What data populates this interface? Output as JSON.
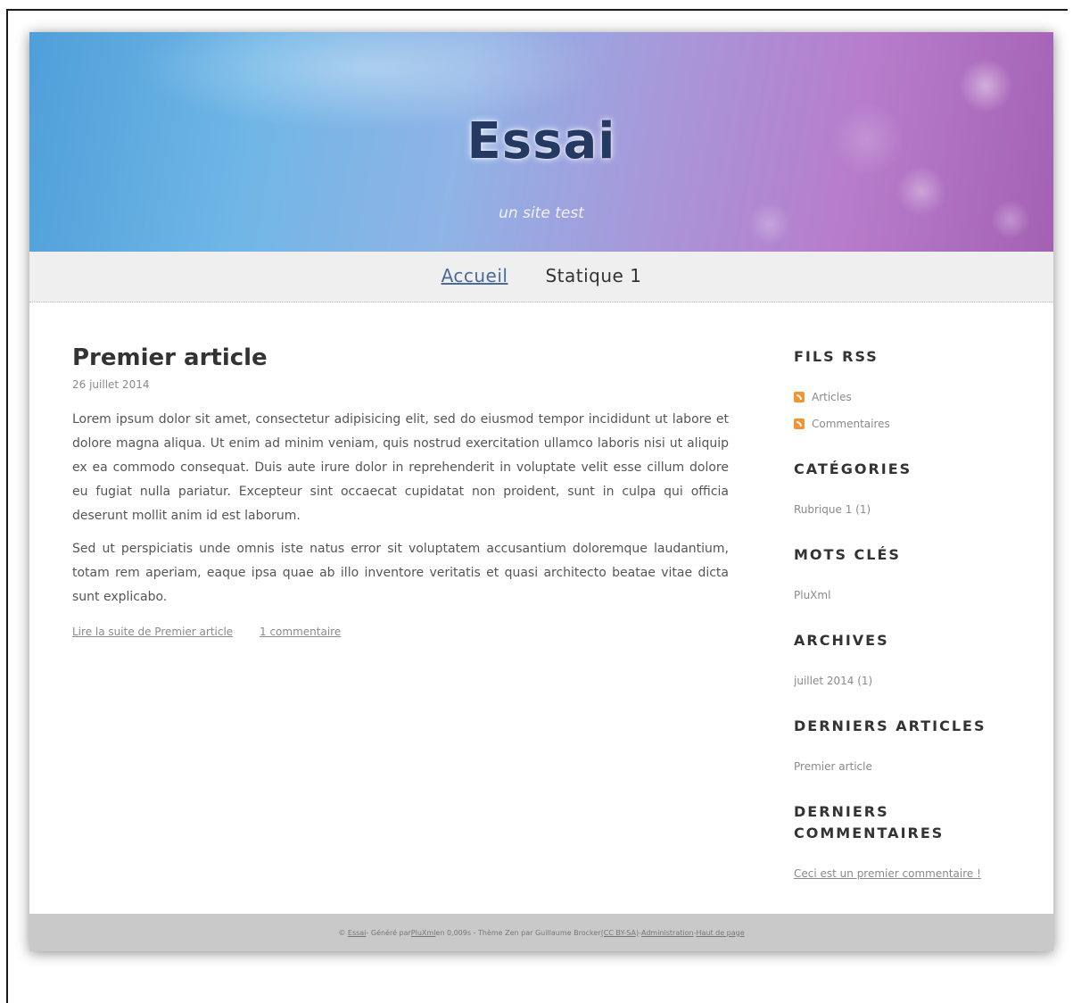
{
  "header": {
    "title": "Essai",
    "subtitle": "un site test"
  },
  "nav": {
    "items": [
      {
        "label": "Accueil",
        "active": true
      },
      {
        "label": "Statique 1",
        "active": false
      }
    ]
  },
  "article": {
    "title": "Premier article",
    "date": "26 juillet 2014",
    "paragraphs": [
      "Lorem ipsum dolor sit amet, consectetur adipisicing elit, sed do eiusmod tempor incididunt ut labore et dolore magna aliqua. Ut enim ad minim veniam, quis nostrud exercitation ullamco laboris nisi ut aliquip ex ea commodo consequat. Duis aute irure dolor in reprehenderit in voluptate velit esse cillum dolore eu fugiat nulla pariatur. Excepteur sint occaecat cupidatat non proident, sunt in culpa qui officia deserunt mollit anim id est laborum.",
      "Sed ut perspiciatis unde omnis iste natus error sit voluptatem accusantium doloremque laudantium, totam rem aperiam, eaque ipsa quae ab illo inventore veritatis et quasi architecto beatae vitae dicta sunt explicabo."
    ],
    "read_more": "Lire la suite de Premier article",
    "comments": "1 commentaire"
  },
  "sidebar": {
    "rss": {
      "title": "FILS RSS",
      "items": [
        "Articles",
        "Commentaires"
      ],
      "icon": "rss-icon",
      "icon_color": "#f29433"
    },
    "categories": {
      "title": "CATÉGORIES",
      "items": [
        "Rubrique 1 (1)"
      ]
    },
    "tags": {
      "title": "MOTS CLÉS",
      "items": [
        "PluXml"
      ]
    },
    "archives": {
      "title": "ARCHIVES",
      "items": [
        "juillet 2014 (1)"
      ]
    },
    "latest_articles": {
      "title": "DERNIERS ARTICLES",
      "items": [
        "Premier article"
      ]
    },
    "latest_comments": {
      "title": "DERNIERS COMMENTAIRES",
      "items": [
        "Ceci est un premier commentaire !"
      ]
    }
  },
  "footer": {
    "copyright": "©",
    "site_link": "Essai",
    "generated_prefix": " - Généré par ",
    "pluxml_link": "PluXml",
    "time_text": " en 0,009s - Thème Zen par Guillaume Brocker ",
    "license_link": "(CC BY-SA)",
    "sep1": " - ",
    "admin_link": "Administration",
    "sep2": " - ",
    "top_link": "Haut de page"
  },
  "colors": {
    "title": "#243a63",
    "nav_active": "#4a6b9a",
    "footer_bg": "#c9c9c9"
  }
}
